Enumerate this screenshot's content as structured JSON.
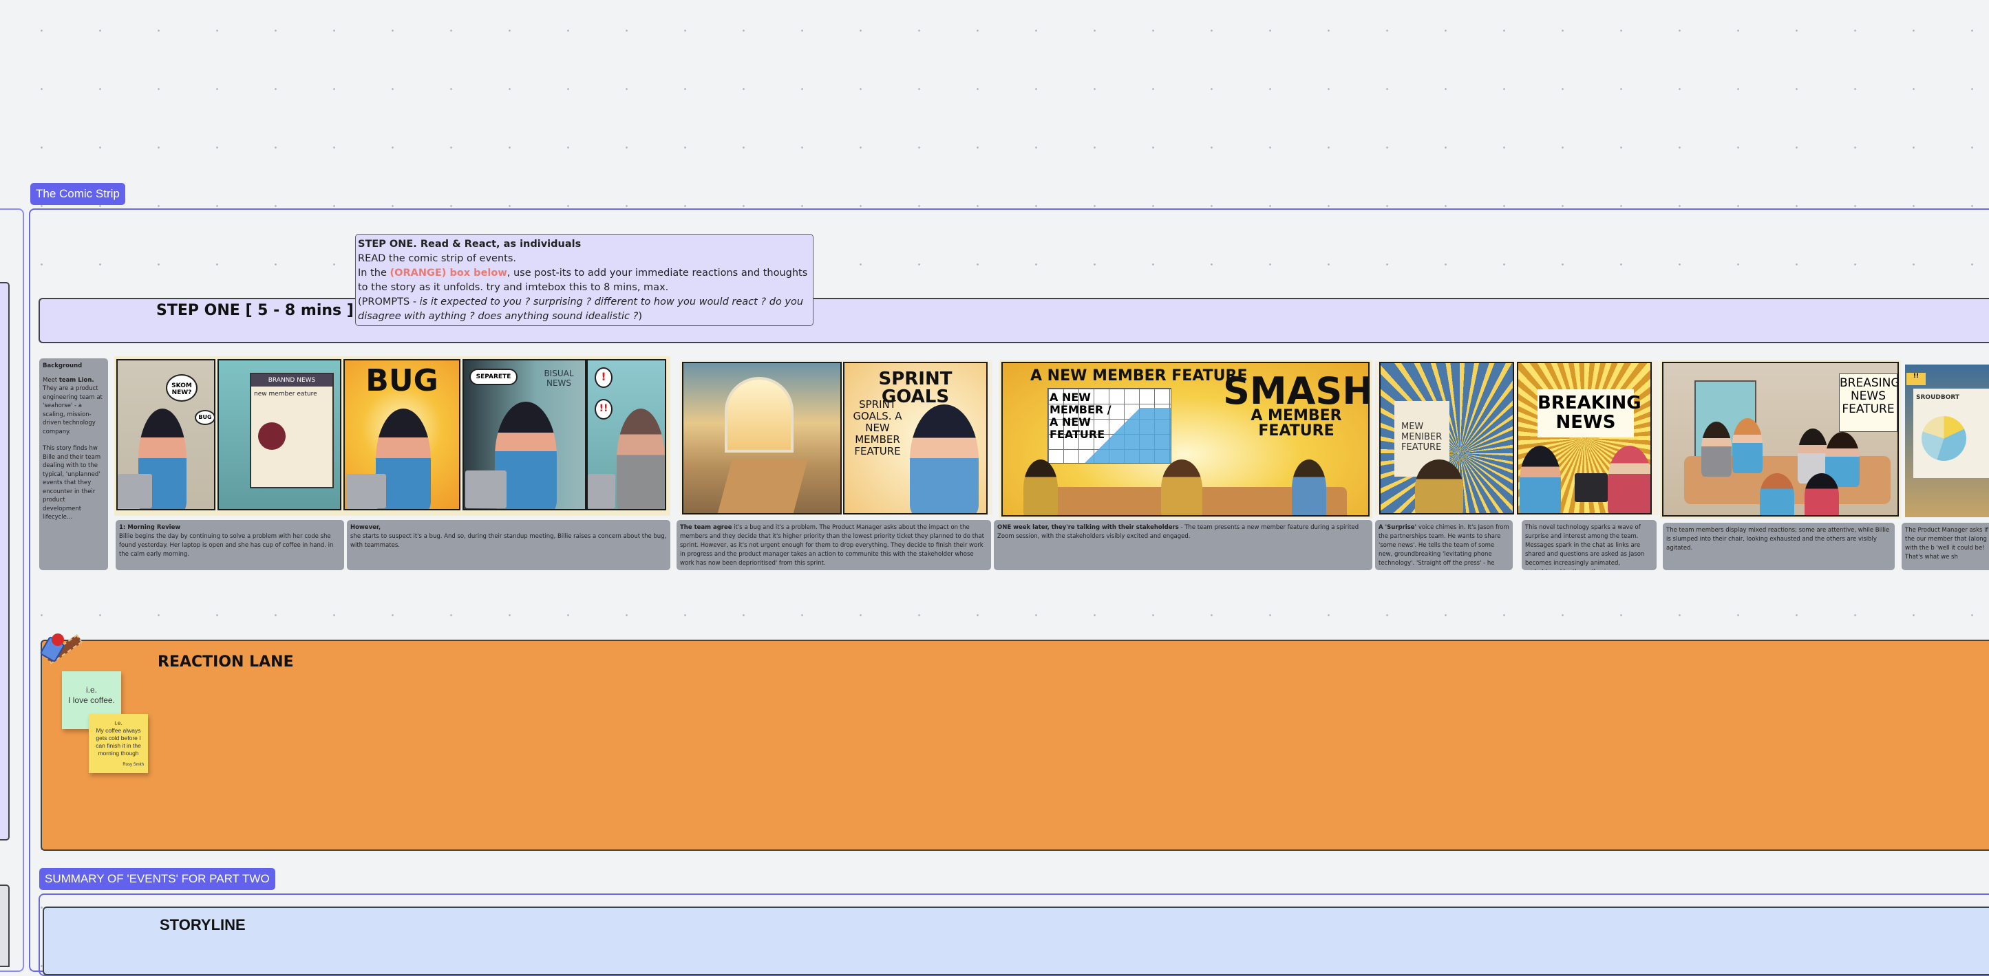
{
  "frames": {
    "comic_strip_label": "The Comic Strip",
    "summary_label": "SUMMARY OF 'EVENTS' FOR PART TWO"
  },
  "step_one": {
    "lane_title": "STEP ONE [ 5 - 8 mins ]",
    "instruction": {
      "heading": "STEP ONE.  Read & React, as individuals",
      "line1": "READ the comic strip of events.",
      "line2_prefix": "In the ",
      "line2_highlight": "(ORANGE) box below",
      "line2_suffix": ", use post-its to add your immediate reactions and thoughts to the story as it unfolds. try and imtebox this to 8 mins, max.",
      "prompts_prefix": " (PROMPTS - ",
      "prompts_italic": "is it expected to you ? surprising ? different to how you would react ? do you disagree with aything ? does anything sound idealistic ?",
      "prompts_suffix": ")"
    }
  },
  "background_card": {
    "title": "Background",
    "para1_prefix": "Meet ",
    "para1_bold": "team Lion.",
    "para1_suffix": " They are a product engineering team at 'seahorse' - a scaling, mission-driven technology company.",
    "para2": "This story finds hw Bille and their team dealing with to the typical, 'unplanned' events that they encounter in their product development lifecycle..."
  },
  "panels": [
    {
      "headline": "SKOM NEW?",
      "extra": "BUG"
    },
    {
      "headline": "BRANND NEWS",
      "extra": "new member eature"
    },
    {
      "headline": "BUG",
      "extra": ""
    },
    {
      "headline": "SEPARETE",
      "extra": "BISUAL NEWS"
    },
    {
      "headline": "!",
      "extra": "!!"
    },
    {
      "headline": "",
      "extra": ""
    },
    {
      "headline": "SPRINT GOALS",
      "extra": "SPRINT GOALS. A NEW MEMBER FEATURE"
    },
    {
      "headline": "A NEW MEMBER FEATURE",
      "extra": "A NEW MEMBER / A NEW FEATURE"
    },
    {
      "headline": "SMASHING",
      "extra": "A MEMBER FEATURE"
    },
    {
      "headline": "MEW MENIBER FEATURE",
      "extra": ""
    },
    {
      "headline": "BREAKING NEWS",
      "extra": ""
    },
    {
      "headline": "BREASING NEWS FEATURE",
      "extra": ""
    },
    {
      "headline": "SROUDBORT",
      "extra": ""
    }
  ],
  "captions": [
    {
      "bold": "1: Morning Review",
      "text": "Billie begins the day by continuing to solve a problem with her code she found yesterday. Her laptop is open and she has cup of coffee in hand. in the calm early morning."
    },
    {
      "bold": "However,",
      "text": "she starts to suspect it's a bug. And so, during their standup meeting, Billie raises a concern about the bug, with teammates."
    },
    {
      "bold": "The team agree",
      "text": " it's a bug and it's a problem. The Product Manager asks about the impact on the members and they decide that it's higher priority than the lowest priority ticket they planned to do that sprint. However, as it's not urgent enough for them to drop everything. They decide to finish their work in progress and the product manager takes an action to communite this with the stakeholder whose work has now been deprioritised' from this sprint."
    },
    {
      "bold": "ONE week later, they're talking with their stakeholders",
      "text": " - The team presents a new member feature during a spirited Zoom session, with the stakeholders visibly excited and engaged."
    },
    {
      "bold": "A 'Surprise'",
      "text": " voice chimes in. It's Jason from the partnerships team. He wants to share 'some news'. He tells the team of some new, groundbreaking 'levitating phone technology'. 'Straight off the press' - he says."
    },
    {
      "bold": "",
      "text": "This novel technology sparks a wave of surprise and interest among the team. Messages spark in the chat as links are shared and questions are asked as Jason becomes increasingly animated, emboldened by the enthusiasm."
    },
    {
      "bold": "",
      "text": "The team members display mixed reactions; some are attentive, while Billie is slumped into their chair, looking exhausted and the others are visibly agitated."
    },
    {
      "bold": "",
      "text": "The Product Manager asks if the our member that (along with the b 'well it could be! That's what we sh"
    }
  ],
  "reaction_lane": {
    "title": "REACTION LANE",
    "stickies": [
      {
        "text_line1": "i.e.",
        "text_line2": "I love coffee.",
        "author": "",
        "color": "#c5f1d2"
      },
      {
        "text_line1": "i.e.",
        "text_line2": "My coffee always gets cold before I can finish it in the morning though",
        "author": "Rosy Smith",
        "color": "#f8e064"
      }
    ]
  },
  "storyline": {
    "title": "STORYLINE"
  },
  "colors": {
    "accent": "#6262ec",
    "frame_border": "#6b6be0",
    "step_lane_bg": "#dedcfa",
    "reaction_lane_bg": "#ee9a49",
    "storyline_bg": "#d2e1f9",
    "caption_bg": "#9a9ea6",
    "canvas_bg": "#f2f3f5"
  }
}
